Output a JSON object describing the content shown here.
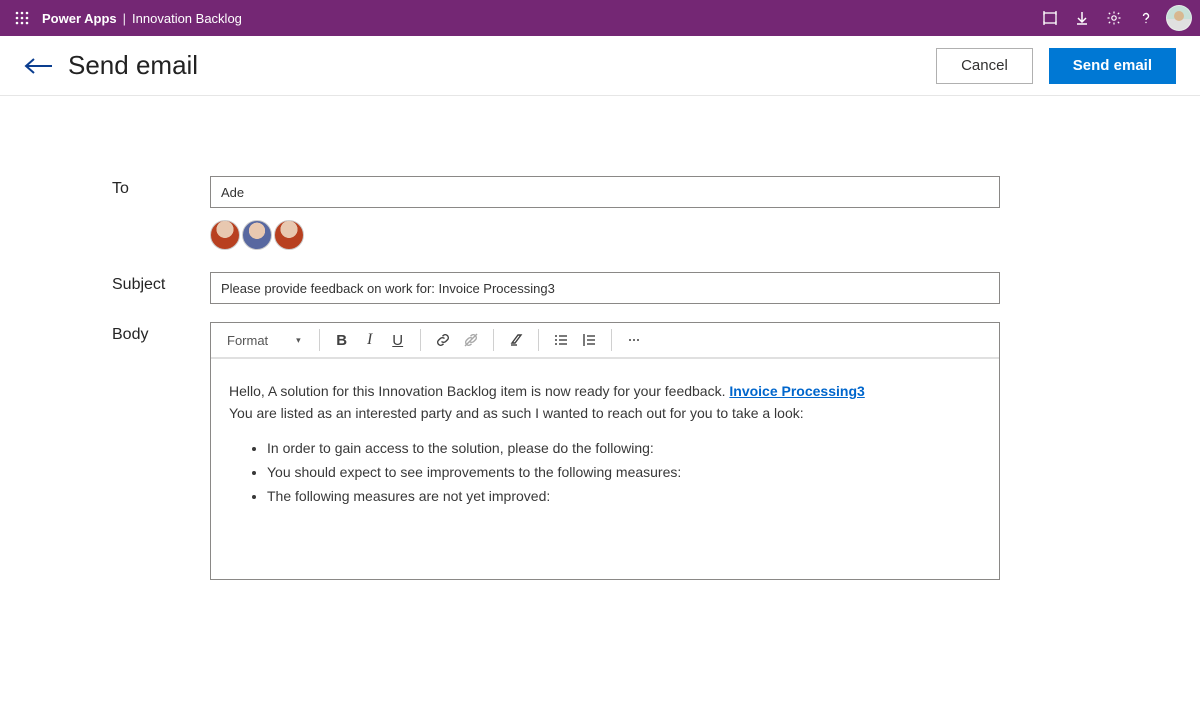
{
  "header": {
    "brand": "Power Apps",
    "app_name": "Innovation Backlog"
  },
  "page": {
    "title": "Send email",
    "cancel_label": "Cancel",
    "send_label": "Send email"
  },
  "form": {
    "to_label": "To",
    "to_value": "Ade",
    "subject_label": "Subject",
    "subject_value": "Please provide feedback on work for: Invoice Processing3",
    "body_label": "Body"
  },
  "toolbar": {
    "format_label": "Format"
  },
  "body": {
    "intro_prefix": "Hello, A solution for this Innovation Backlog item is now ready for your feedback. ",
    "link_text": "Invoice Processing3",
    "line2": "You are listed as an interested party and as such I wanted to reach out for you to take a look:",
    "bullets": [
      "In order to gain access to the solution, please do the following:",
      "You should expect to see improvements to the following measures:",
      "The following measures are not yet improved:"
    ]
  }
}
